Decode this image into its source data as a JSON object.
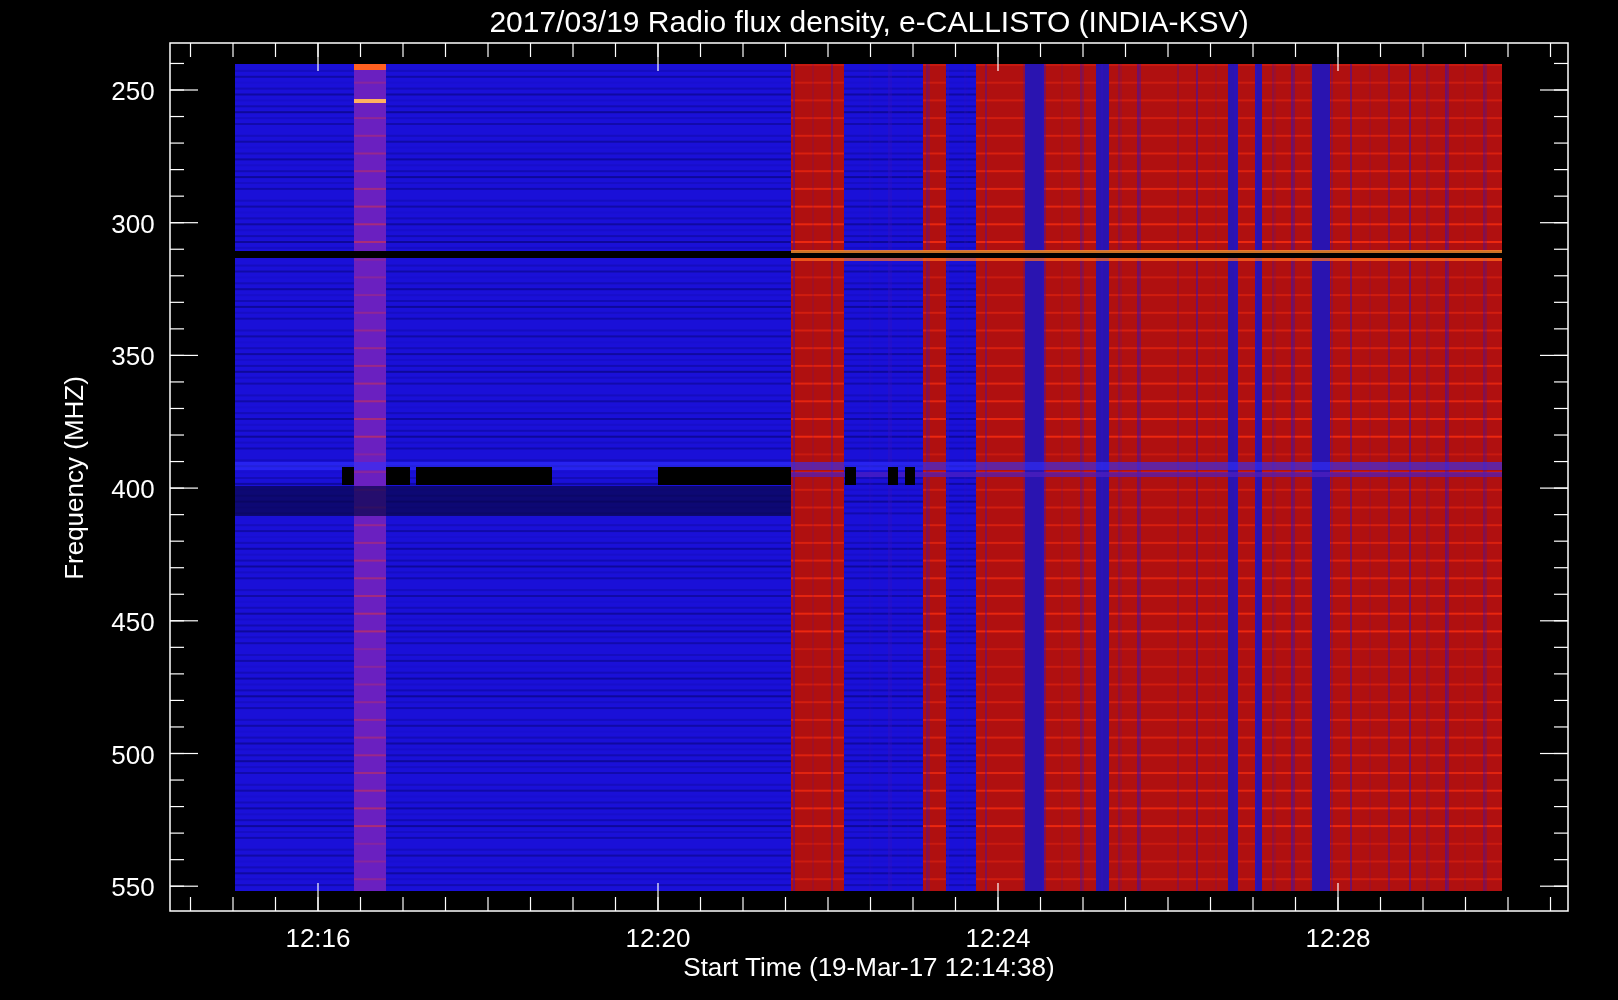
{
  "title": "2017/03/19  Radio flux density, e-CALLISTO (INDIA-KSV)",
  "plot": {
    "ylabel": "Frequency (MHZ)",
    "xlabel": "Start Time (19-Mar-17 12:14:38)",
    "yticks": [
      "250",
      "300",
      "350",
      "400",
      "450",
      "500",
      "550"
    ],
    "xticks": [
      "12:16",
      "12:20",
      "12:24",
      "12:28"
    ]
  }
}
